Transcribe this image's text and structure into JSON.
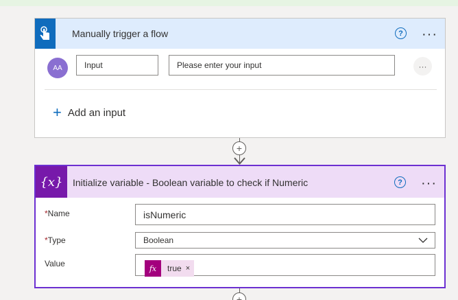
{
  "trigger_card": {
    "title": "Manually trigger a flow",
    "help_glyph": "?",
    "more_glyph": "···",
    "input_avatar": "AA",
    "input_name": "Input",
    "input_placeholder": "Please enter your input",
    "row_more_glyph": "···",
    "add_input_label": "Add an input",
    "icon": "touch-hand-icon",
    "accent_color": "#0f6cbd"
  },
  "connector": {
    "plus_glyph": "+"
  },
  "variable_card": {
    "title": "Initialize variable - Boolean variable to check if Numeric",
    "icon_glyph": "{x}",
    "help_glyph": "?",
    "more_glyph": "···",
    "accent_color": "#7719aa",
    "fields": {
      "name_label": "Name",
      "name_value": "isNumeric",
      "type_label": "Type",
      "type_value": "Boolean",
      "value_label": "Value",
      "value_token_icon": "fx",
      "value_token_text": "true",
      "value_token_remove": "×"
    },
    "required_mark": "*"
  }
}
